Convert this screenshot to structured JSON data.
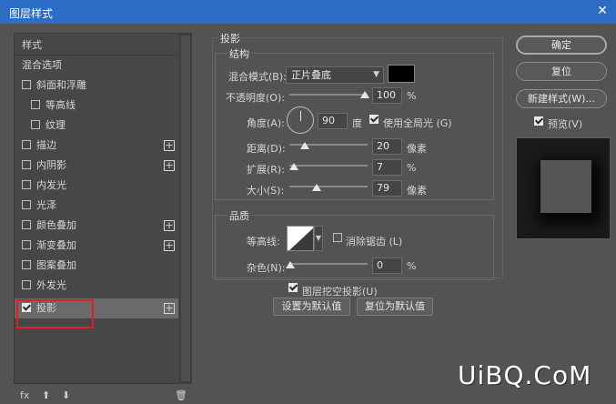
{
  "window": {
    "title": "图层样式",
    "close_glyph": "✕"
  },
  "style_list": {
    "items": [
      {
        "label": "样式",
        "checkbox": false,
        "checked": false,
        "plus": false,
        "indent": false
      },
      {
        "label": "混合选项",
        "checkbox": false,
        "checked": false,
        "plus": false,
        "indent": false
      },
      {
        "label": "斜面和浮雕",
        "checkbox": true,
        "checked": false,
        "plus": false,
        "indent": false
      },
      {
        "label": "等高线",
        "checkbox": true,
        "checked": false,
        "plus": false,
        "indent": true
      },
      {
        "label": "纹理",
        "checkbox": true,
        "checked": false,
        "plus": false,
        "indent": true
      },
      {
        "label": "描边",
        "checkbox": true,
        "checked": false,
        "plus": true,
        "indent": false
      },
      {
        "label": "内阴影",
        "checkbox": true,
        "checked": false,
        "plus": true,
        "indent": false
      },
      {
        "label": "内发光",
        "checkbox": true,
        "checked": false,
        "plus": false,
        "indent": false
      },
      {
        "label": "光泽",
        "checkbox": true,
        "checked": false,
        "plus": false,
        "indent": false
      },
      {
        "label": "颜色叠加",
        "checkbox": true,
        "checked": false,
        "plus": true,
        "indent": false
      },
      {
        "label": "渐变叠加",
        "checkbox": true,
        "checked": false,
        "plus": true,
        "indent": false
      },
      {
        "label": "图案叠加",
        "checkbox": true,
        "checked": false,
        "plus": false,
        "indent": false
      },
      {
        "label": "外发光",
        "checkbox": true,
        "checked": false,
        "plus": false,
        "indent": false
      },
      {
        "label": "投影",
        "checkbox": true,
        "checked": true,
        "plus": true,
        "indent": false,
        "selected": true
      }
    ],
    "footer": {
      "fx": "fx",
      "up": "⬆",
      "down": "⬇",
      "trash": "🗑"
    }
  },
  "drop_shadow": {
    "section_title": "投影",
    "structure": {
      "title": "结构",
      "blend_mode_label": "混合模式(B):",
      "blend_mode_value": "正片叠底",
      "shadow_color": "#000000",
      "opacity_label": "不透明度(O):",
      "opacity_value": "100",
      "opacity_unit": "%",
      "angle_label": "角度(A):",
      "angle_value": "90",
      "angle_unit": "度",
      "global_light_label": "使用全局光 (G)",
      "global_light_checked": true,
      "distance_label": "距离(D):",
      "distance_value": "20",
      "distance_unit": "像素",
      "spread_label": "扩展(R):",
      "spread_value": "7",
      "spread_unit": "%",
      "size_label": "大小(S):",
      "size_value": "79",
      "size_unit": "像素"
    },
    "quality": {
      "title": "品质",
      "contour_label": "等高线:",
      "antialias_label": "消除锯齿 (L)",
      "antialias_checked": false,
      "noise_label": "杂色(N):",
      "noise_value": "0",
      "noise_unit": "%"
    },
    "knockout_label": "图层挖空投影(U)",
    "knockout_checked": true,
    "make_default_label": "设置为默认值",
    "reset_default_label": "复位为默认值"
  },
  "actions": {
    "ok": "确定",
    "reset": "复位",
    "new_style": "新建样式(W)...",
    "preview_label": "预览(V)",
    "preview_checked": true
  },
  "watermark": "UiBQ.CoM",
  "colors": {
    "titlebar": "#2b6cc4",
    "panel": "#535353",
    "highlight": "#e02020"
  }
}
